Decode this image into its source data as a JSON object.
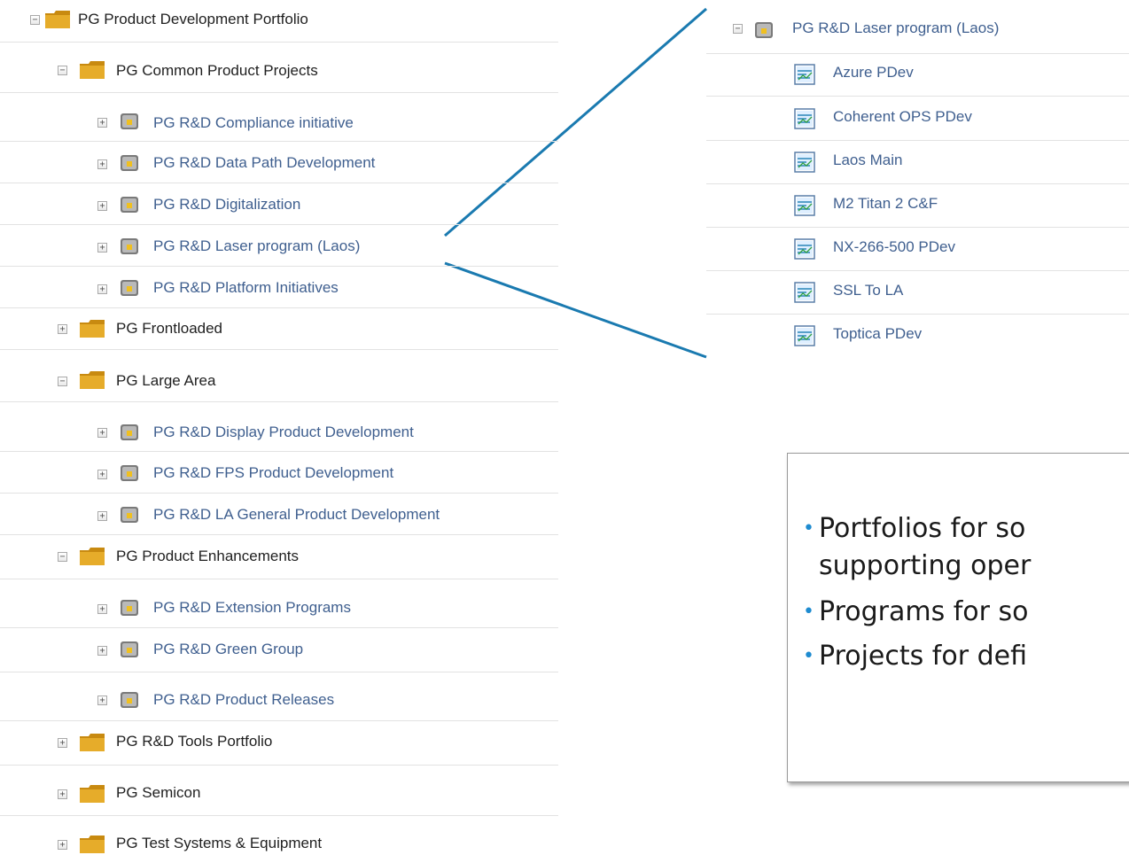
{
  "tree": {
    "rows": [
      {
        "label": "PG Product Development Portfolio",
        "kind": "folder",
        "expander": "−"
      },
      {
        "label": "PG Common Product Projects",
        "kind": "folder",
        "expander": "−"
      },
      {
        "label": "PG R&D Compliance initiative",
        "kind": "program",
        "expander": "+"
      },
      {
        "label": "PG R&D Data Path Development",
        "kind": "program",
        "expander": "+"
      },
      {
        "label": "PG R&D Digitalization",
        "kind": "program",
        "expander": "+"
      },
      {
        "label": "PG R&D Laser program (Laos)",
        "kind": "program",
        "expander": "+"
      },
      {
        "label": "PG R&D Platform Initiatives",
        "kind": "program",
        "expander": "+"
      },
      {
        "label": "PG Frontloaded",
        "kind": "folder",
        "expander": "+"
      },
      {
        "label": "PG Large Area",
        "kind": "folder",
        "expander": "−"
      },
      {
        "label": "PG R&D Display Product Development",
        "kind": "program",
        "expander": "+"
      },
      {
        "label": "PG R&D FPS Product Development",
        "kind": "program",
        "expander": "+"
      },
      {
        "label": "PG R&D LA General Product Development",
        "kind": "program",
        "expander": "+"
      },
      {
        "label": "PG Product Enhancements",
        "kind": "folder",
        "expander": "−"
      },
      {
        "label": "PG R&D Extension Programs",
        "kind": "program",
        "expander": "+"
      },
      {
        "label": "PG R&D Green Group",
        "kind": "program",
        "expander": "+"
      },
      {
        "label": "PG R&D Product Releases",
        "kind": "program",
        "expander": "+"
      },
      {
        "label": "PG R&D Tools Portfolio",
        "kind": "folder",
        "expander": "+"
      },
      {
        "label": "PG Semicon",
        "kind": "folder",
        "expander": "+"
      },
      {
        "label": "PG Test Systems & Equipment",
        "kind": "folder",
        "expander": "+"
      }
    ]
  },
  "detail": {
    "program": {
      "label": "PG R&D Laser program (Laos)",
      "expander": "−"
    },
    "projects": [
      {
        "label": "Azure PDev"
      },
      {
        "label": "Coherent OPS PDev"
      },
      {
        "label": "Laos Main"
      },
      {
        "label": "M2 Titan 2 C&F"
      },
      {
        "label": "NX-266-500 PDev"
      },
      {
        "label": "SSL To LA"
      },
      {
        "label": "Toptica PDev"
      }
    ]
  },
  "callout": {
    "items": [
      {
        "text": "Portfolios for so"
      },
      {
        "text": "supporting oper"
      },
      {
        "text": "Programs for so"
      },
      {
        "text": "Projects for defi"
      }
    ]
  },
  "colors": {
    "connector": "#1a7ab0",
    "bullet": "#1e8bd0",
    "folder": "#d49a1c",
    "program_label": "#3f5f8f"
  }
}
